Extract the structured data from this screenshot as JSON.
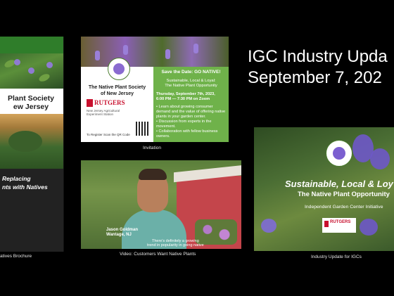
{
  "heading": {
    "line1": "IGC Industry Upda",
    "line2": "September 7, 202"
  },
  "brochure": {
    "title_line1": "Plant Society",
    "title_line2": "ew Jersey",
    "tagline_line1": "Replacing",
    "tagline_line2": "nts with Natives",
    "caption": "atives Brochure"
  },
  "invitation": {
    "title_line1": "The Native Plant Society",
    "title_line2": "of New Jersey",
    "rutgers": "RUTGERS",
    "sub": "New Jersey Agricultural Experiment Station",
    "register": "To Register Scan the QR Code",
    "save_date": "Save the Date: GO NATIVE!",
    "theme_line1": "Sustainable, Local & Loyal:",
    "theme_line2": "The Native Plant Opportunity",
    "date": "Thursday, September 7th, 2023,",
    "time": "6:00 PM — 7:30 PM on Zoom",
    "bullet1": "• Learn about growing consumer demand and the value of offering native plants in your garden center.",
    "bullet2": "• Discussion from experts in the movement.",
    "bullet3": "• Collaboration with fellow business owners.",
    "caption": "Invitation"
  },
  "video": {
    "name": "Jason Goldman",
    "place": "Wantage, NJ",
    "quote_line1": "There's definitely a growing",
    "quote_line2": "trend in popularity in going native",
    "caption": "Video: Customers Want Native Plants"
  },
  "igc_card": {
    "title": "Sustainable, Local & Loy",
    "subtitle": "The Native Plant Opportunity",
    "initiative": "Independent Garden Center Initiative",
    "rutgers": "RUTGERS",
    "caption": "Industry Update for IGCs"
  }
}
